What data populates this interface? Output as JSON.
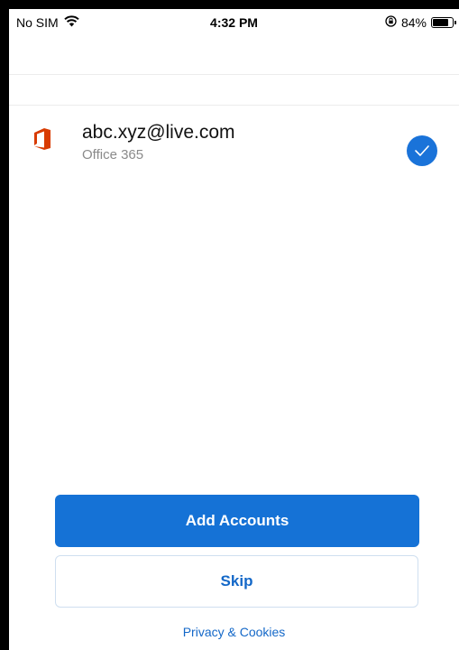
{
  "status_bar": {
    "carrier": "No SIM",
    "time": "4:32 PM",
    "battery_percent": "84%",
    "battery_level": 0.84
  },
  "account": {
    "email": "abc.xyz@live.com",
    "type": "Office 365",
    "icon": "office-logo-icon",
    "selected": true
  },
  "actions": {
    "add_accounts_label": "Add Accounts",
    "skip_label": "Skip",
    "privacy_label": "Privacy & Cookies"
  },
  "colors": {
    "accent": "#1572d6",
    "office_red": "#d83b01",
    "secondary_text": "#8a8a8a"
  }
}
